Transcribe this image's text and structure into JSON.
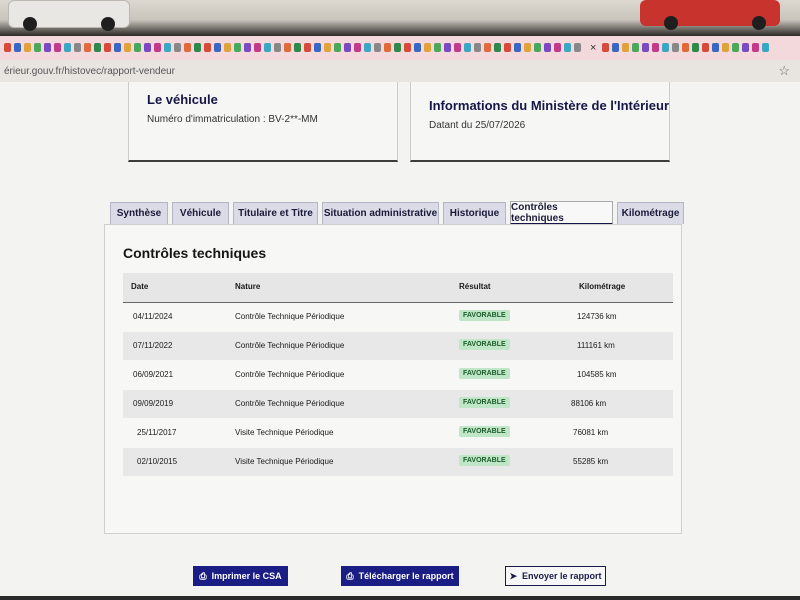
{
  "browser": {
    "url": "érieur.gouv.fr/histovec/rapport-vendeur",
    "close_label": "×",
    "bookmark_icon": "star-icon",
    "favicon_colors": [
      "#d64a3a",
      "#3a67c2",
      "#e0a23a",
      "#4aa85a",
      "#7a4ac2",
      "#c23a8a",
      "#3aa8c2",
      "#888888",
      "#e06a3a",
      "#2d8a4a"
    ]
  },
  "vehicle_card": {
    "title": "Le véhicule",
    "plate_label": "Numéro d'immatriculation : BV-2**-MM"
  },
  "ministry_card": {
    "title": "Informations du Ministère de l'Intérieur",
    "date_label": "Datant du 25/07/2026"
  },
  "tabs": [
    {
      "label": "Synthèse"
    },
    {
      "label": "Véhicule"
    },
    {
      "label": "Titulaire et Titre"
    },
    {
      "label": "Situation administrative"
    },
    {
      "label": "Historique"
    },
    {
      "label": "Contrôles techniques"
    },
    {
      "label": "Kilométrage"
    }
  ],
  "active_tab": "Contrôles techniques",
  "section": {
    "title": "Contrôles techniques",
    "columns": [
      "Date",
      "Nature",
      "Résultat",
      "Kilométrage"
    ],
    "rows": [
      {
        "date": "04/11/2024",
        "nature": "Contrôle Technique Périodique",
        "result": "FAVORABLE",
        "km": "124736 km"
      },
      {
        "date": "07/11/2022",
        "nature": "Contrôle Technique Périodique",
        "result": "FAVORABLE",
        "km": "111161 km"
      },
      {
        "date": "06/09/2021",
        "nature": "Contrôle Technique Périodique",
        "result": "FAVORABLE",
        "km": "104585 km"
      },
      {
        "date": "09/09/2019",
        "nature": "Contrôle Technique Périodique",
        "result": "FAVORABLE",
        "km": "88106 km"
      },
      {
        "date": "25/11/2017",
        "nature": "Visite Technique Périodique",
        "result": "FAVORABLE",
        "km": "76081 km"
      },
      {
        "date": "02/10/2015",
        "nature": "Visite Technique Périodique",
        "result": "FAVORABLE",
        "km": "55285 km"
      }
    ]
  },
  "buttons": {
    "print": "Imprimer le CSA",
    "download": "Télécharger le rapport",
    "send": "Envoyer le rapport"
  },
  "colors": {
    "primary": "#1a1d84",
    "success_bg": "#bfe6c6",
    "success_text": "#1d5c2c"
  }
}
